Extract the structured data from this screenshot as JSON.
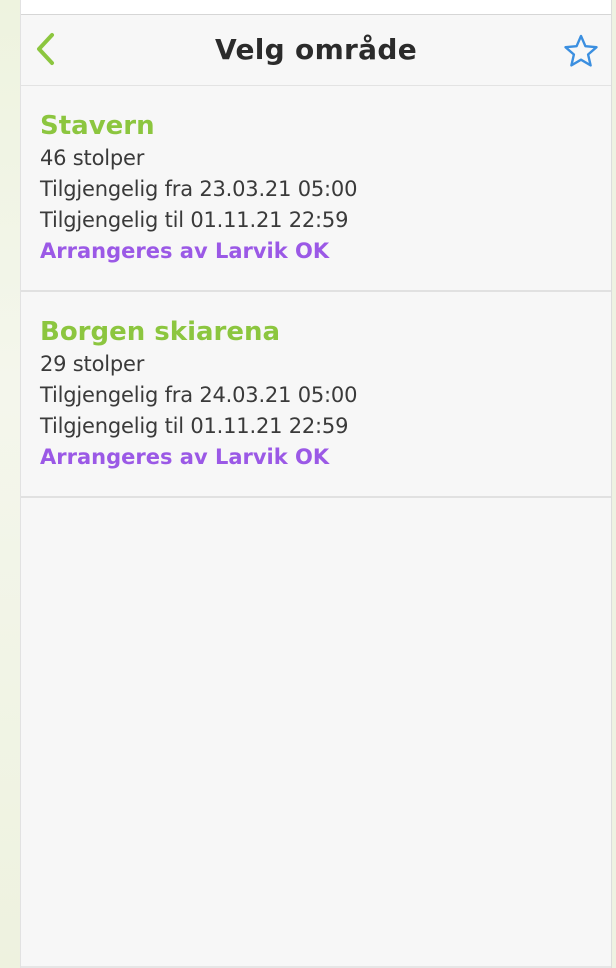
{
  "header": {
    "title": "Velg område",
    "back_icon": "chevron-left-icon",
    "favorite_icon": "star-outline-icon"
  },
  "areas": [
    {
      "name": "Stavern",
      "posts": "46 stolper",
      "available_from": "Tilgjengelig fra 23.03.21 05:00",
      "available_to": "Tilgjengelig til 01.11.21 22:59",
      "organizer": "Arrangeres av Larvik OK"
    },
    {
      "name": "Borgen skiarena",
      "posts": "29 stolper",
      "available_from": "Tilgjengelig fra 24.03.21 05:00",
      "available_to": "Tilgjengelig til 01.11.21 22:59",
      "organizer": "Arrangeres av Larvik OK"
    }
  ],
  "colors": {
    "area_name": "#8cc63f",
    "organizer": "#9b59e6",
    "back_icon": "#8cc63f",
    "star_icon": "#3b8fe0",
    "title": "#2b2b2b"
  }
}
